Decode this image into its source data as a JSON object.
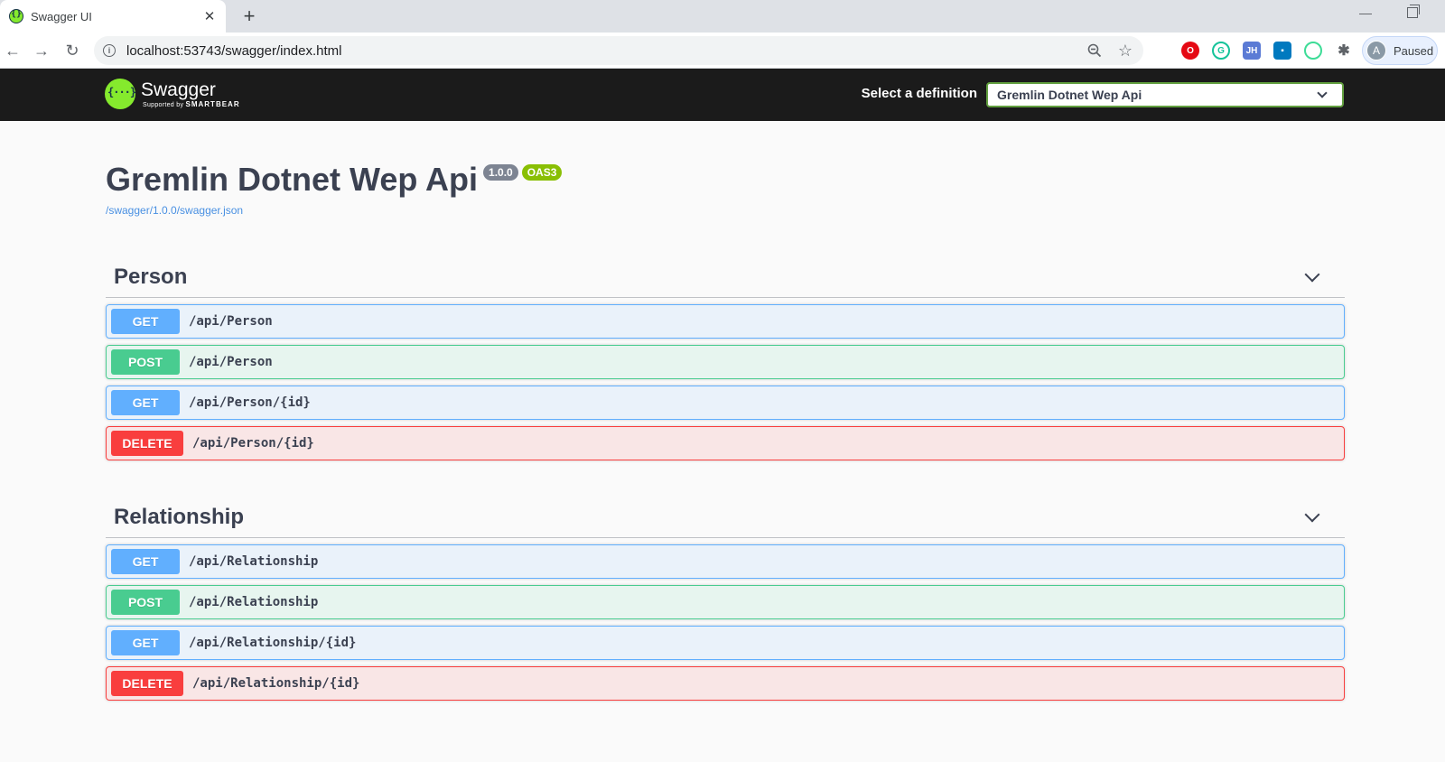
{
  "browser": {
    "tab_title": "Swagger UI",
    "url": "localhost:53743/swagger/index.html",
    "profile_label": "Paused",
    "profile_initial": "A",
    "extensions": [
      "opera-icon",
      "grammarly-icon",
      "jh-icon",
      "trello-icon",
      "color-picker-icon",
      "extensions-icon"
    ]
  },
  "topbar": {
    "logo_title": "Swagger",
    "logo_sub_prefix": "Supported by",
    "logo_sub_brand": "SMARTBEAR",
    "definition_label": "Select a definition",
    "definition_selected": "Gremlin Dotnet Wep Api"
  },
  "info": {
    "title": "Gremlin Dotnet Wep Api",
    "version": "1.0.0",
    "oas_badge": "OAS3",
    "spec_url": "/swagger/1.0.0/swagger.json"
  },
  "sections": [
    {
      "name": "Person",
      "operations": [
        {
          "method": "GET",
          "path": "/api/Person"
        },
        {
          "method": "POST",
          "path": "/api/Person"
        },
        {
          "method": "GET",
          "path": "/api/Person/{id}"
        },
        {
          "method": "DELETE",
          "path": "/api/Person/{id}"
        }
      ]
    },
    {
      "name": "Relationship",
      "operations": [
        {
          "method": "GET",
          "path": "/api/Relationship"
        },
        {
          "method": "POST",
          "path": "/api/Relationship"
        },
        {
          "method": "GET",
          "path": "/api/Relationship/{id}"
        },
        {
          "method": "DELETE",
          "path": "/api/Relationship/{id}"
        }
      ]
    }
  ],
  "colors": {
    "get": "#61affe",
    "post": "#49cc90",
    "delete": "#f93e3e",
    "topbar_bg": "#1b1b1b",
    "swagger_green": "#85ea2d"
  }
}
